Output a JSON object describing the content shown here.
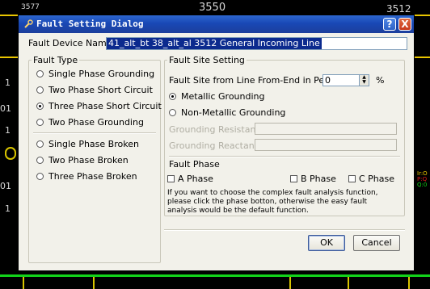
{
  "background": {
    "labels": [
      "3577",
      "3550",
      "3512",
      "1",
      "01",
      "1",
      "01",
      "1"
    ],
    "right_labels": [
      "Ir:O",
      "P:Q",
      "Q:0"
    ],
    "colors": {
      "bus": "#e8c500",
      "line": "#d9c400",
      "green": "#12d31a"
    }
  },
  "dialog": {
    "title": "Fault Setting Dialog",
    "title_icon": "wrench-icon",
    "help_glyph": "?",
    "close_glyph": "X",
    "device_label": "Fault Device Name:",
    "device_value": "41_alt_bt 38_alt_al 3512 General Incoming Line",
    "fault_type": {
      "legend": "Fault Type",
      "options": [
        {
          "label": "Single Phase Grounding",
          "selected": false
        },
        {
          "label": "Two Phase Short Circuit",
          "selected": false
        },
        {
          "label": "Three Phase Short Circuit",
          "selected": true
        },
        {
          "label": "Two Phase Grounding",
          "selected": false
        },
        {
          "label": "Single Phase Broken",
          "selected": false
        },
        {
          "label": "Two Phase Broken",
          "selected": false
        },
        {
          "label": "Three Phase Broken",
          "selected": false
        }
      ]
    },
    "site_setting": {
      "legend": "Fault Site Setting",
      "percent_label": "Fault Site from Line From-End in Percent",
      "percent_value": "0",
      "percent_unit": "%",
      "metallic_label": "Metallic Grounding",
      "metallic_selected": true,
      "non_metallic_label": "Non-Metallic Grounding",
      "non_metallic_selected": false,
      "grounding_resistance_label": "Grounding Resistance",
      "grounding_reactance_label": "Grounding Reactance"
    },
    "fault_phase": {
      "title": "Fault Phase",
      "phases": [
        {
          "label": "A Phase",
          "checked": false
        },
        {
          "label": "B Phase",
          "checked": false
        },
        {
          "label": "C Phase",
          "checked": false
        }
      ],
      "note": "If you want to choose the complex fault analysis function, please click the phase botton, otherwise the easy fault analysis would be the default function."
    },
    "buttons": {
      "ok": "OK",
      "cancel": "Cancel"
    }
  }
}
